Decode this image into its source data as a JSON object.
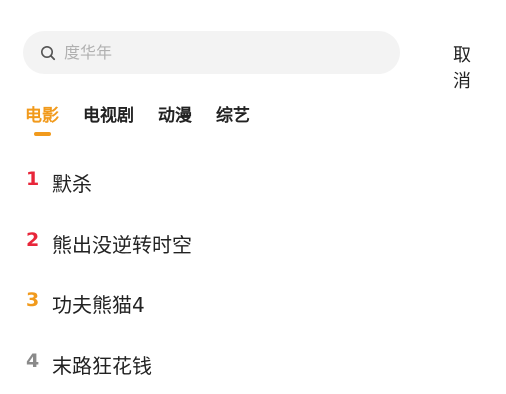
{
  "search": {
    "placeholder": "度华年",
    "cancel_label": "取消"
  },
  "tabs": [
    {
      "label": "电影",
      "active": true
    },
    {
      "label": "电视剧",
      "active": false
    },
    {
      "label": "动漫",
      "active": false
    },
    {
      "label": "综艺",
      "active": false
    }
  ],
  "ranking": [
    {
      "rank": "1",
      "title": "默杀",
      "color": "#e8263a"
    },
    {
      "rank": "2",
      "title": "熊出没逆转时空",
      "color": "#e8263a"
    },
    {
      "rank": "3",
      "title": "功夫熊猫4",
      "color": "#f19a1c"
    },
    {
      "rank": "4",
      "title": "末路狂花钱",
      "color": "#8a8a8a"
    }
  ],
  "colors": {
    "accent": "#f19a1c",
    "rank_top": "#e8263a",
    "rank_other": "#8a8a8a"
  }
}
